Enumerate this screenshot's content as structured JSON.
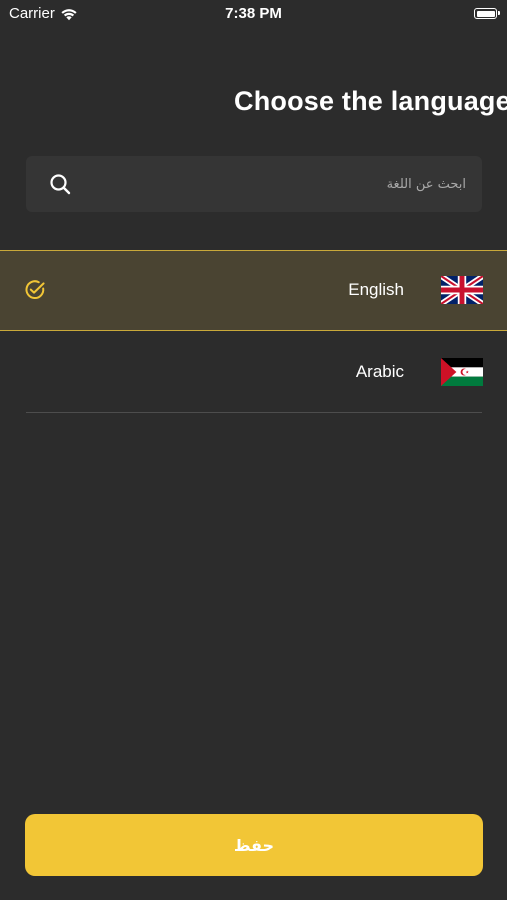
{
  "status_bar": {
    "carrier": "Carrier",
    "time": "7:38 PM",
    "wifi_icon": "wifi-icon",
    "battery_icon": "battery-icon"
  },
  "header": {
    "title": "Choose the language"
  },
  "search": {
    "placeholder": "ابحث عن اللغة",
    "value": "",
    "icon": "search-icon"
  },
  "languages": [
    {
      "label": "English",
      "flag": "uk-flag-icon",
      "selected": true
    },
    {
      "label": "Arabic",
      "flag": "sahrawi-flag-icon",
      "selected": false
    }
  ],
  "footer": {
    "save_label": "حفظ"
  },
  "colors": {
    "background": "#2c2c2c",
    "search_background": "#353535",
    "selected_row_background": "#4a4432",
    "accent": "#f2c636",
    "selected_border": "#c9a93a",
    "divider": "#4d4d4d"
  }
}
